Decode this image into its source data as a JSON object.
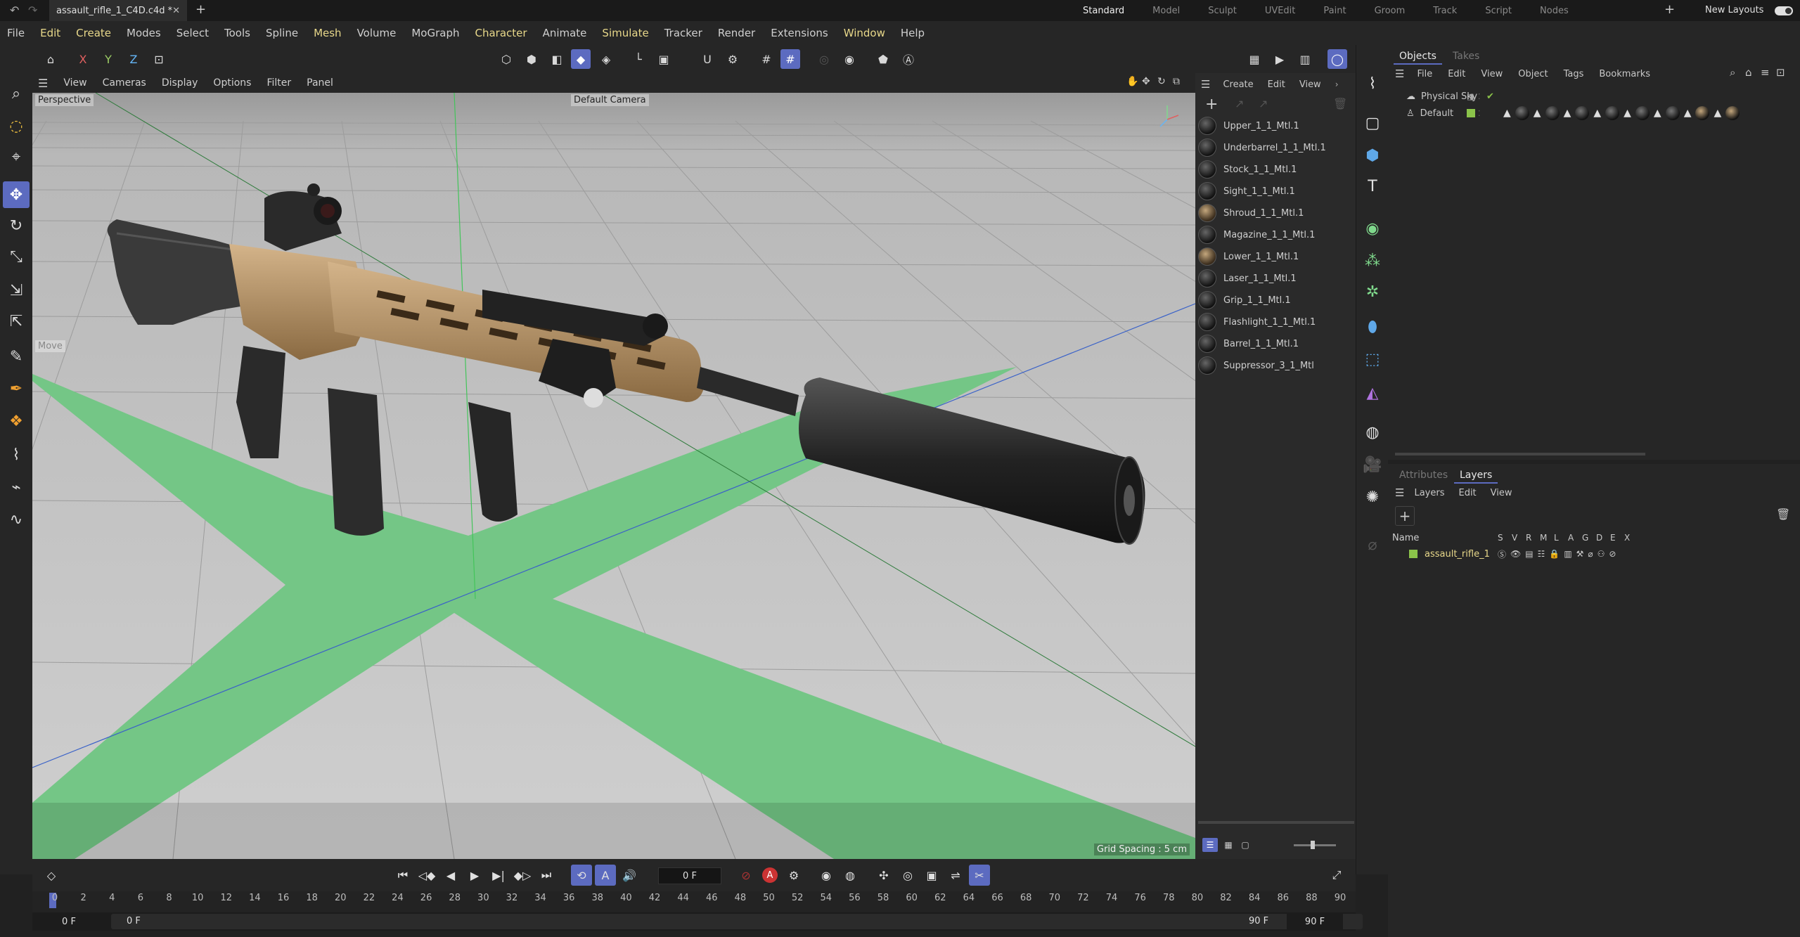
{
  "tab": {
    "filename": "assault_rifle_1_C4D.c4d *"
  },
  "layouts": [
    "Standard",
    "Model",
    "Sculpt",
    "UVEdit",
    "Paint",
    "Groom",
    "Track",
    "Script",
    "Nodes"
  ],
  "new_layouts_label": "New Layouts",
  "menu": [
    "File",
    "Edit",
    "Create",
    "Modes",
    "Select",
    "Tools",
    "Spline",
    "Mesh",
    "Volume",
    "MoGraph",
    "Character",
    "Animate",
    "Simulate",
    "Tracker",
    "Render",
    "Extensions",
    "Window",
    "Help"
  ],
  "highlighted_menus": [
    "Edit",
    "Create",
    "Mesh",
    "Character",
    "Simulate",
    "Window"
  ],
  "toolbar_axes": [
    "X",
    "Y",
    "Z"
  ],
  "viewport_menu": [
    "View",
    "Cameras",
    "Display",
    "Options",
    "Filter",
    "Panel"
  ],
  "viewport": {
    "projection": "Perspective",
    "camera": "Default Camera",
    "move_label": "Move",
    "grid_spacing": "Grid Spacing : 5 cm"
  },
  "material_menu": [
    "Create",
    "Edit",
    "View"
  ],
  "materials": [
    {
      "name": "Upper_1_1_Mtl.1",
      "tan": false
    },
    {
      "name": "Underbarrel_1_1_Mtl.1",
      "tan": false
    },
    {
      "name": "Stock_1_1_Mtl.1",
      "tan": false
    },
    {
      "name": "Sight_1_1_Mtl.1",
      "tan": false
    },
    {
      "name": "Shroud_1_1_Mtl.1",
      "tan": true
    },
    {
      "name": "Magazine_1_1_Mtl.1",
      "tan": false
    },
    {
      "name": "Lower_1_1_Mtl.1",
      "tan": true
    },
    {
      "name": "Laser_1_1_Mtl.1",
      "tan": false
    },
    {
      "name": "Grip_1_1_Mtl.1",
      "tan": false
    },
    {
      "name": "Flashlight_1_1_Mtl.1",
      "tan": false
    },
    {
      "name": "Barrel_1_1_Mtl.1",
      "tan": false
    },
    {
      "name": "Suppressor_3_1_Mtl",
      "tan": false
    }
  ],
  "objects_panel": {
    "tabs": [
      "Objects",
      "Takes"
    ],
    "menu": [
      "File",
      "Edit",
      "View",
      "Object",
      "Tags",
      "Bookmarks"
    ],
    "items": [
      "Physical Sky",
      "Default"
    ]
  },
  "layers_panel": {
    "tabs": [
      "Attributes",
      "Layers"
    ],
    "menu": [
      "Layers",
      "Edit",
      "View"
    ],
    "name_header": "Name",
    "flag_headers": [
      "S",
      "V",
      "R",
      "M",
      "L",
      "A",
      "G",
      "D",
      "E",
      "X"
    ],
    "layer_name": "assault_rifle_1",
    "layer_color": "#8bc34a"
  },
  "timeline": {
    "current_frame": "0 F",
    "ticks": [
      0,
      2,
      4,
      6,
      8,
      10,
      12,
      14,
      16,
      18,
      20,
      22,
      24,
      26,
      28,
      30,
      32,
      34,
      36,
      38,
      40,
      42,
      44,
      46,
      48,
      50,
      52,
      54,
      56,
      58,
      60,
      62,
      64,
      66,
      68,
      70,
      72,
      74,
      76,
      78,
      80,
      82,
      84,
      86,
      88,
      90
    ],
    "range_start": "0 F",
    "range_start_inner": "0 F",
    "range_end_inner": "90 F",
    "range_end": "90 F"
  },
  "colors": {
    "accent": "#5c6bc0",
    "grid_green": "#6cc97e",
    "viewport_bg": "#c8c8c8"
  }
}
